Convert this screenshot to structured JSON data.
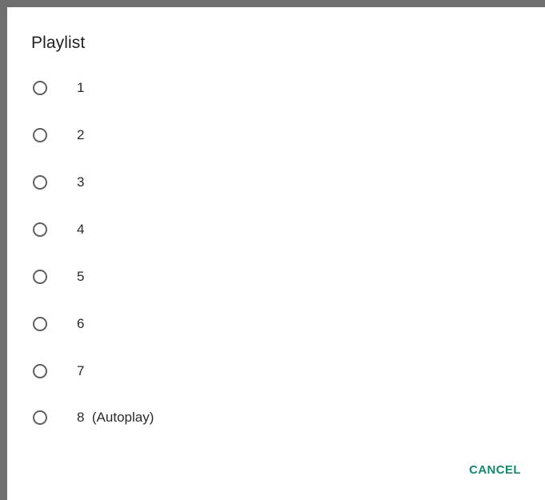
{
  "dialog": {
    "title": "Playlist",
    "options": [
      {
        "label": "1",
        "selected": false
      },
      {
        "label": "2",
        "selected": false
      },
      {
        "label": "3",
        "selected": false
      },
      {
        "label": "4",
        "selected": false
      },
      {
        "label": "5",
        "selected": false
      },
      {
        "label": "6",
        "selected": false
      },
      {
        "label": "7",
        "selected": false
      },
      {
        "label": "8  (Autoplay)",
        "selected": false
      }
    ],
    "cancel_label": "CANCEL"
  },
  "colors": {
    "accent": "#138a72",
    "radio_border": "#5f5f5f",
    "backdrop_edge": "#6f6f6f"
  },
  "icons": {
    "radio": "radio-unchecked-icon"
  }
}
